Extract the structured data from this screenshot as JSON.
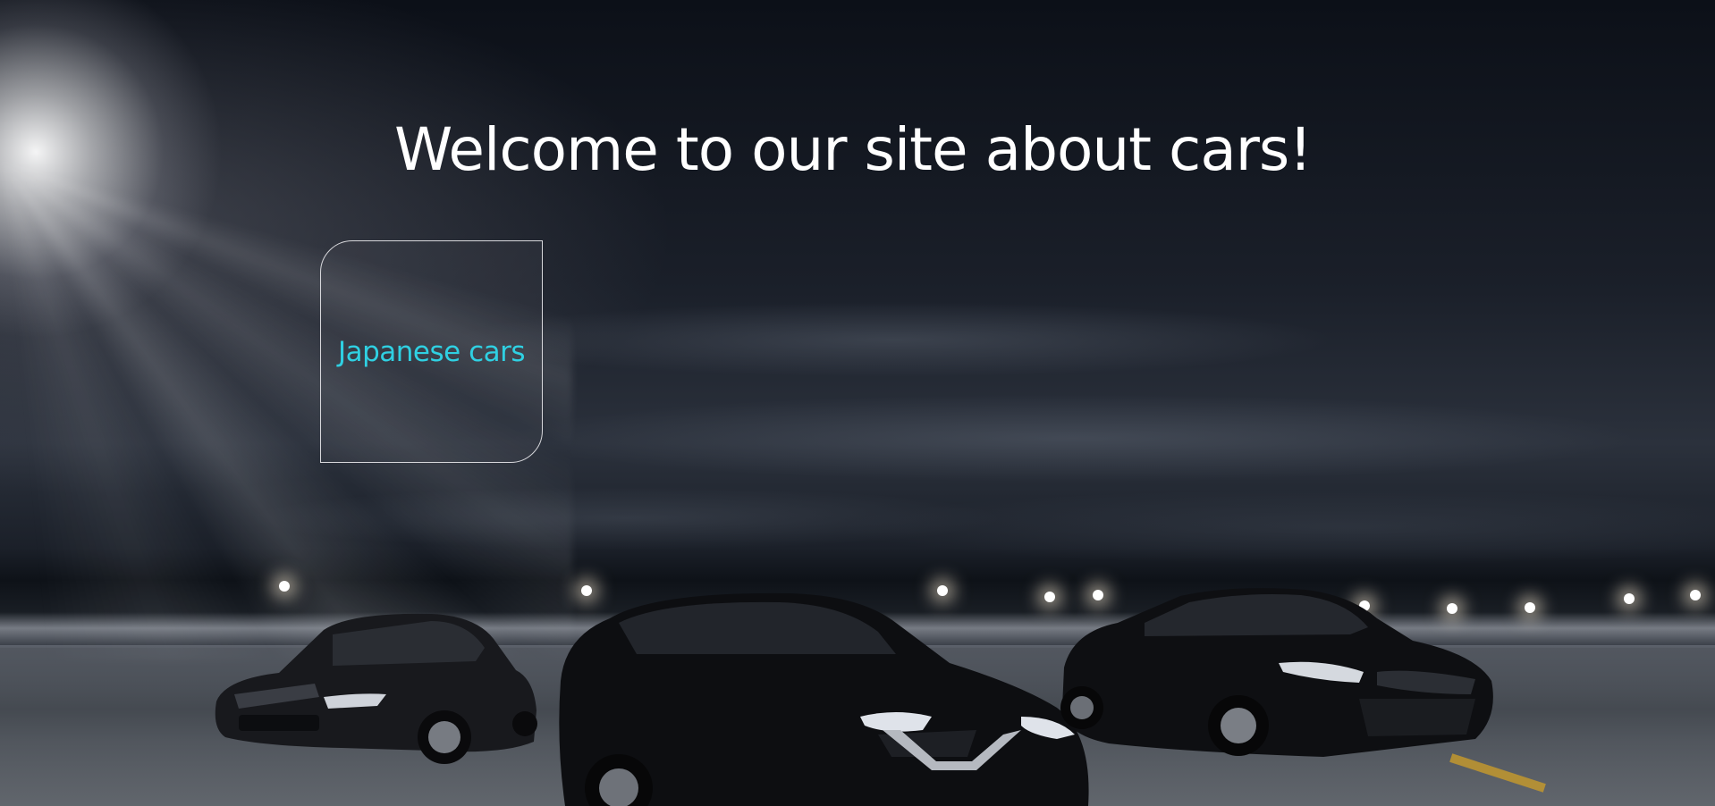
{
  "hero": {
    "title": "Welcome to our site about cars!"
  },
  "nav_cards": [
    {
      "label": "Japanese cars"
    }
  ],
  "colors": {
    "card_label": "#2fd0e2",
    "title": "#ffffff",
    "card_border": "#d7d7db"
  },
  "background": {
    "description_icon": "night-airport-three-black-cars-image"
  }
}
